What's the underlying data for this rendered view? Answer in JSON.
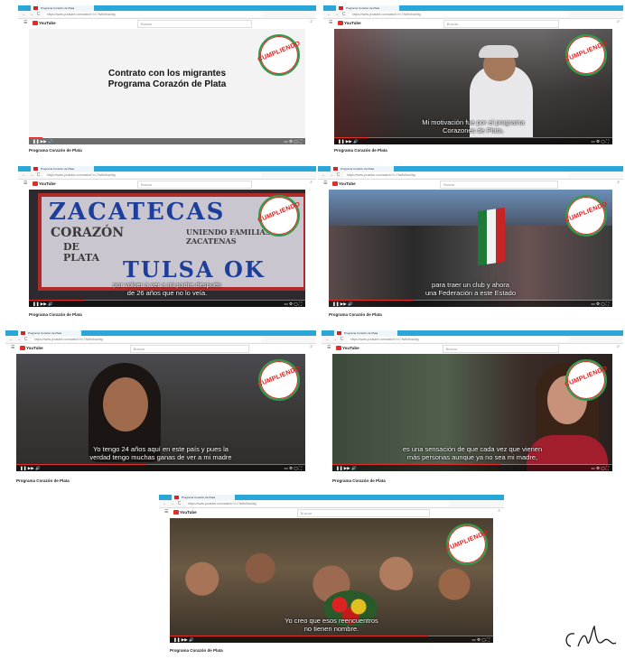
{
  "browser": {
    "tab_title": "Programa Corazón de Plata",
    "url": "https://www.youtube.com/watch?v=7hv8x5xa4hg",
    "nav_glyphs": "← → C",
    "youtube_label": "YouTube",
    "search_placeholder": "Buscar"
  },
  "badge_text": "CUMPLIENDO",
  "caption": "Programa Corazón de Plata",
  "colors": {
    "youtube_red": "#e52d27",
    "chrome_blue": "#2aa7d8",
    "badge_green": "#2a9d4b"
  },
  "screenshots": [
    {
      "id": "s1",
      "title_line1": "Contrato con los migrantes",
      "title_line2": "Programa Corazón de Plata",
      "subtitle": "",
      "progress": 0.05
    },
    {
      "id": "s2",
      "title_line1": "",
      "title_line2": "",
      "subtitle_line1": "Mi motivación fue por el programa",
      "subtitle_line2": "Corazones de Plata.",
      "progress": 0.12
    },
    {
      "id": "s3",
      "sign_top": "ZACATECAS",
      "sign_mid1": "CORAZÓN",
      "sign_mid2": "UNIENDO FAMILIAS ZACATENAS",
      "sign_mid3": "DE PLATA",
      "sign_bottom": "TULSA OK",
      "subtitle_line1": "por volver a ver a mi padre después",
      "subtitle_line2": "de 26 años que no lo veía.",
      "progress": 0.2
    },
    {
      "id": "s4",
      "subtitle_line1": "para traer un club y ahora",
      "subtitle_line2": "una Federación a este Estado",
      "progress": 0.3
    },
    {
      "id": "s5",
      "subtitle_line1": "Yo tengo 24 años aquí en este país y pues la",
      "subtitle_line2": "verdad tengo muchas ganas de ver a mi madre",
      "progress": 0.45
    },
    {
      "id": "s6",
      "subtitle_line1": "es una sensación de que cada vez que vienen",
      "subtitle_line2": "más personas aunque ya no sea mi madre,",
      "progress": 0.6
    },
    {
      "id": "s7",
      "subtitle_line1": "Yo creo que esos reencuentros",
      "subtitle_line2": "no tienen nombre.",
      "progress": 0.8
    }
  ]
}
